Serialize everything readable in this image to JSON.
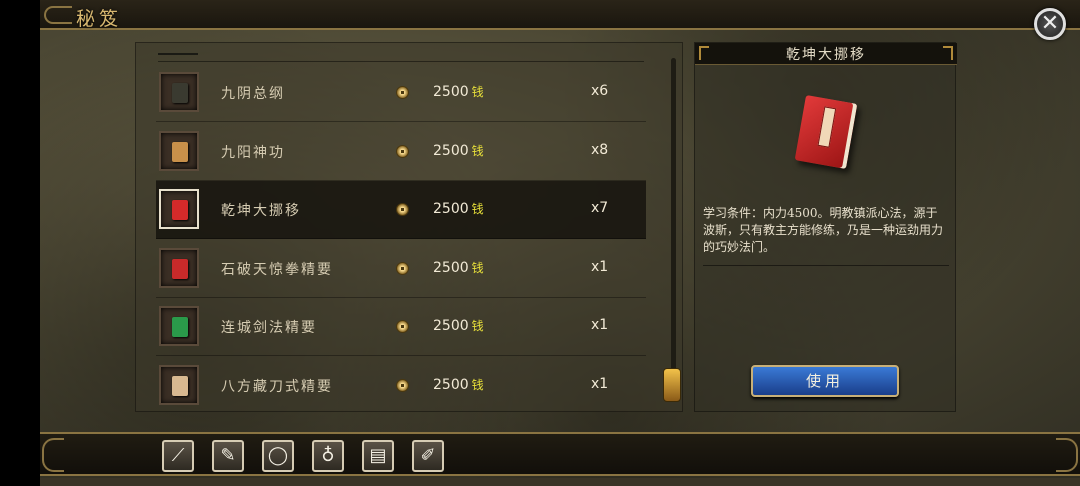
{
  "header": {
    "title": "秘笈"
  },
  "list": {
    "price_unit": "钱",
    "items": [
      {
        "name": "九阴总纲",
        "price": "2500",
        "count": "x6",
        "book_color": "#3a3a30",
        "selected": false
      },
      {
        "name": "九阳神功",
        "price": "2500",
        "count": "x8",
        "book_color": "#c8904a",
        "selected": false
      },
      {
        "name": "乾坤大挪移",
        "price": "2500",
        "count": "x7",
        "book_color": "#d42a2a",
        "selected": true
      },
      {
        "name": "石破天惊拳精要",
        "price": "2500",
        "count": "x1",
        "book_color": "#c82a2a",
        "selected": false
      },
      {
        "name": "连城剑法精要",
        "price": "2500",
        "count": "x1",
        "book_color": "#2a9a4a",
        "selected": false
      },
      {
        "name": "八方藏刀式精要",
        "price": "2500",
        "count": "x1",
        "book_color": "#d8b890",
        "selected": false
      }
    ]
  },
  "detail": {
    "title": "乾坤大挪移",
    "description": "学习条件：内力4500。明教镇派心法，源于波斯，只有教主方能修练，乃是一种运劲用力的巧妙法门。",
    "use_label": "使用"
  },
  "toolbar": {
    "buttons": [
      {
        "name": "sword-icon",
        "glyph": "⟋"
      },
      {
        "name": "armor-icon",
        "glyph": "✎"
      },
      {
        "name": "ring-icon",
        "glyph": "◯"
      },
      {
        "name": "gourd-icon",
        "glyph": "♁"
      },
      {
        "name": "chest-icon",
        "glyph": "▤"
      },
      {
        "name": "scroll-icon",
        "glyph": "✐"
      }
    ]
  },
  "colors": {
    "accent_gold": "#8a7442",
    "price_unit": "#e8e03a",
    "use_button": "#2a5ab0"
  }
}
